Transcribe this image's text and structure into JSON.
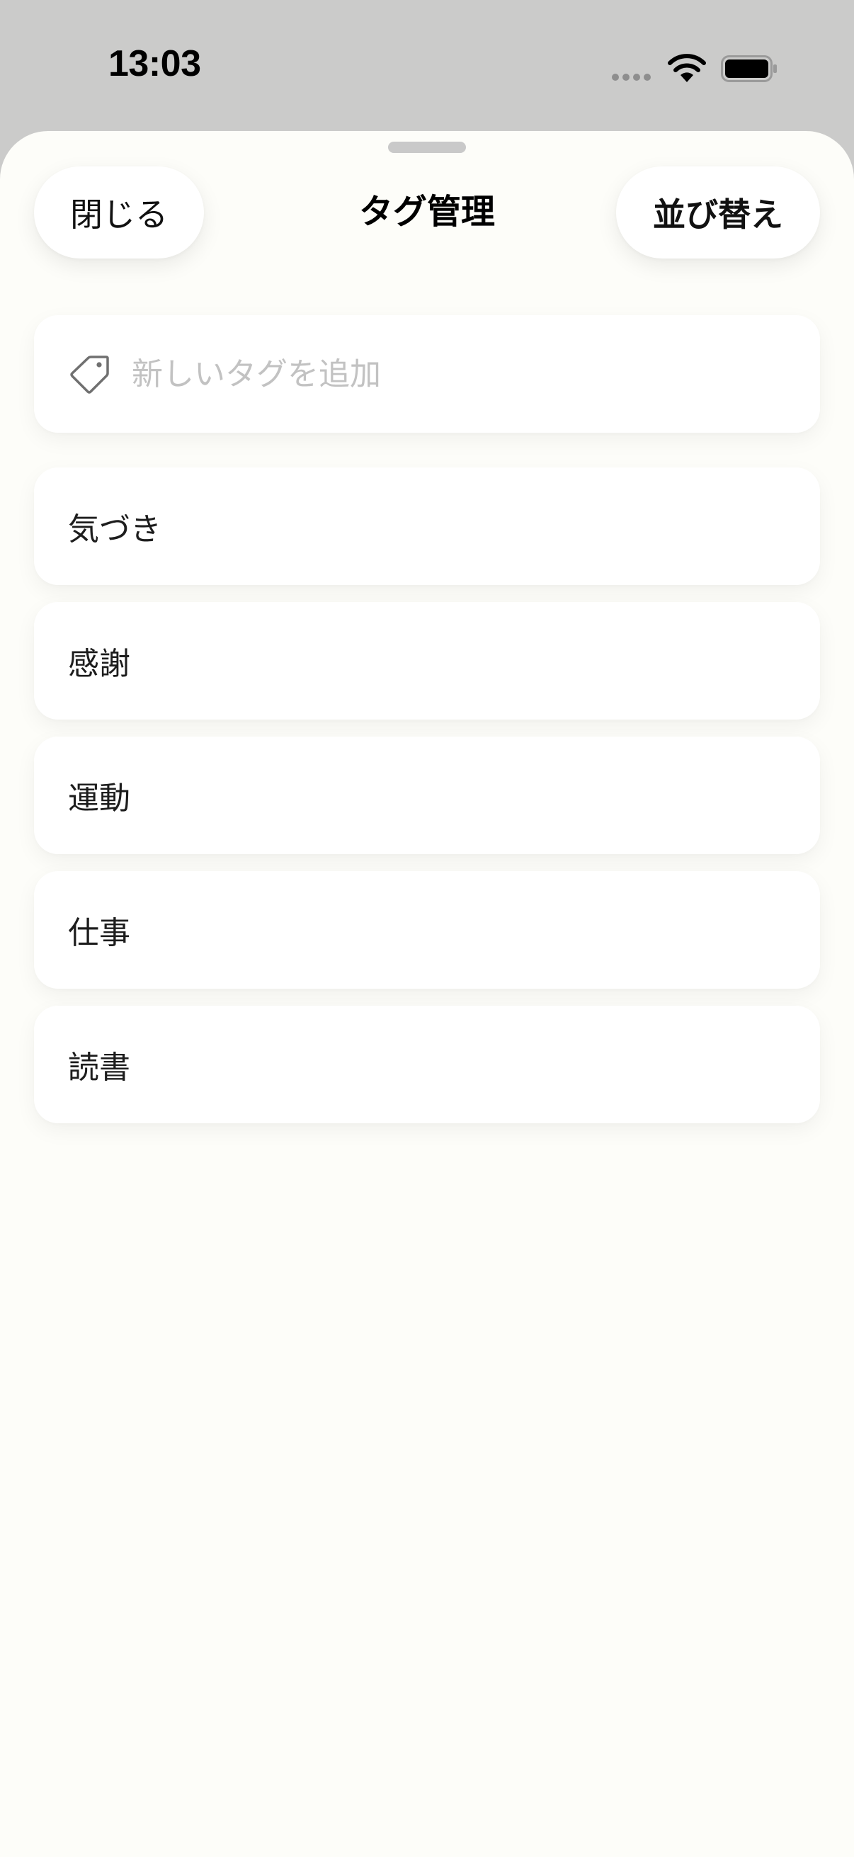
{
  "status_bar": {
    "time": "13:03"
  },
  "header": {
    "close_label": "閉じる",
    "title": "タグ管理",
    "sort_label": "並び替え"
  },
  "add_tag": {
    "placeholder": "新しいタグを追加",
    "value": "",
    "icon": "tag-icon"
  },
  "tags": [
    {
      "label": "気づき"
    },
    {
      "label": "感謝"
    },
    {
      "label": "運動"
    },
    {
      "label": "仕事"
    },
    {
      "label": "読書"
    }
  ],
  "colors": {
    "sheet_background": "#fdfdf9",
    "backdrop": "#cbcbca",
    "placeholder": "#c2c2c2"
  }
}
